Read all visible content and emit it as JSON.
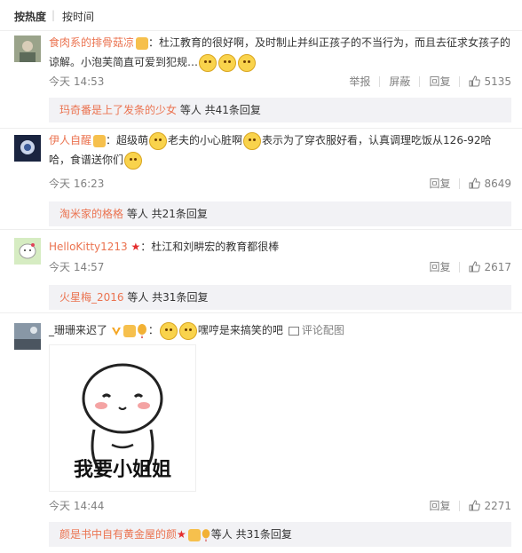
{
  "sort": {
    "hot": "按热度",
    "sep": "|",
    "time": "按时间"
  },
  "comments": [
    {
      "user": "食肉系的排骨菇凉",
      "text": "：杜江教育的很好啊，及时制止并纠正孩子的不当行为，而且去征求女孩子的谅解。小泡芙简直可爱到犯规…",
      "time": "今天 14:53",
      "report": "举报",
      "block": "屏蔽",
      "reply": "回复",
      "likes": "5135",
      "reply_user": "玛奇番是上了发条的少女",
      "reply_summary": " 等人 共41条回复"
    },
    {
      "user": "伊人自醒",
      "text_a": "：超级萌",
      "text_b": "老夫的小心脏啊",
      "text_c": "表示为了穿衣服好看，认真调理吃饭从126-92哈哈，食谱送你们",
      "time": "今天 16:23",
      "reply": "回复",
      "likes": "8649",
      "reply_user": "淘米家的格格",
      "reply_summary": " 等人 共21条回复"
    },
    {
      "user": "HelloKitty1213",
      "text": "：杜江和刘畊宏的教育都很棒",
      "time": "今天 14:57",
      "reply": "回复",
      "likes": "2617",
      "reply_user": "火星梅_2016",
      "reply_summary": " 等人 共31条回复"
    },
    {
      "user": "_珊珊来迟了",
      "text_a": "：",
      "text_b": "嘿哼是来搞笑的吧",
      "pic_link": "评论配图",
      "sticker_text": "我要小姐姐",
      "time": "今天 14:44",
      "reply": "回复",
      "likes": "2271",
      "reply_user": "颜是书中自有黄金屋的颜",
      "reply_summary": "等人 共31条回复"
    }
  ],
  "colors": {
    "username": "#eb7350",
    "meta": "#808080",
    "reply_bg": "#f2f2f5"
  }
}
